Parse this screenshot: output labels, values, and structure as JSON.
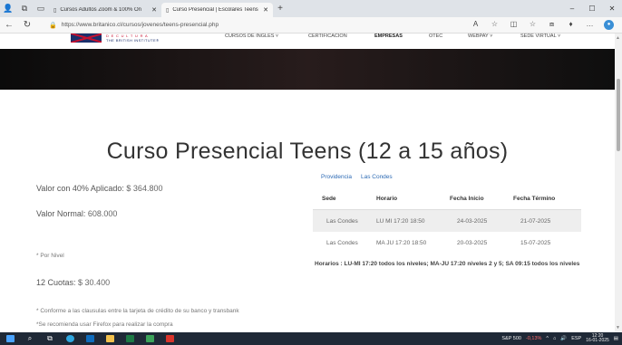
{
  "browser": {
    "tabs": [
      {
        "title": "Cursos Adultos Zoom & 100% On",
        "active": false
      },
      {
        "title": "Curso Presencial | Escolares Teens",
        "active": true
      }
    ],
    "new_tab": "+",
    "url": "https://www.britanico.cl/cursos/jovenes/teens-presencial.php",
    "window_controls": [
      "–",
      "☐",
      "✕"
    ]
  },
  "site": {
    "logo": {
      "line1": "D E   C U L T U R A",
      "line2": "THE BRITISH INSTITUTE®"
    },
    "menu": [
      "CURSOS DE INGLES ˅",
      "CERTIFICACION",
      "EMPRESAS",
      "OTEC",
      "WEBPAY ˅",
      "SEDE VIRTUAL ˅"
    ]
  },
  "main": {
    "title": "Curso Presencial Teens (12 a 15 años)",
    "valor_40": {
      "label": "Valor con 40% Aplicado:",
      "value": "$ 364.800"
    },
    "valor_normal": {
      "label": "Valor Normal:",
      "value": "608.000"
    },
    "por_nivel": "* Por Nivel",
    "cuotas": {
      "label": "12 Cuotas:",
      "value": "$ 30.400"
    },
    "nota1": "* Conforme a las clausulas entre la tarjeta de crédito de su banco y transbank",
    "nota2": "*Se recomienda usar Firefox para realizar la compra",
    "location_tabs": [
      "Providencia",
      "Las Condes"
    ],
    "table": {
      "headers": [
        "Sede",
        "Horario",
        "Fecha Inicio",
        "Fecha Término"
      ],
      "rows": [
        [
          "Las Condes",
          "LU MI 17:20 18:50",
          "24-03-2025",
          "21-07-2025"
        ],
        [
          "Las Condes",
          "MA JU 17:20 18:50",
          "20-03-2025",
          "15-07-2025"
        ]
      ]
    },
    "horarios": "Horarios : LU-MI 17:20 todos los niveles; MA-JU 17:20 niveles 2 y 5; SA 09:15 todos los niveles"
  },
  "taskbar": {
    "stock": {
      "name": "S&P 500",
      "change": "-0,13%"
    },
    "lang": "ESP",
    "time": "12:20",
    "date": "16-01-2025"
  }
}
